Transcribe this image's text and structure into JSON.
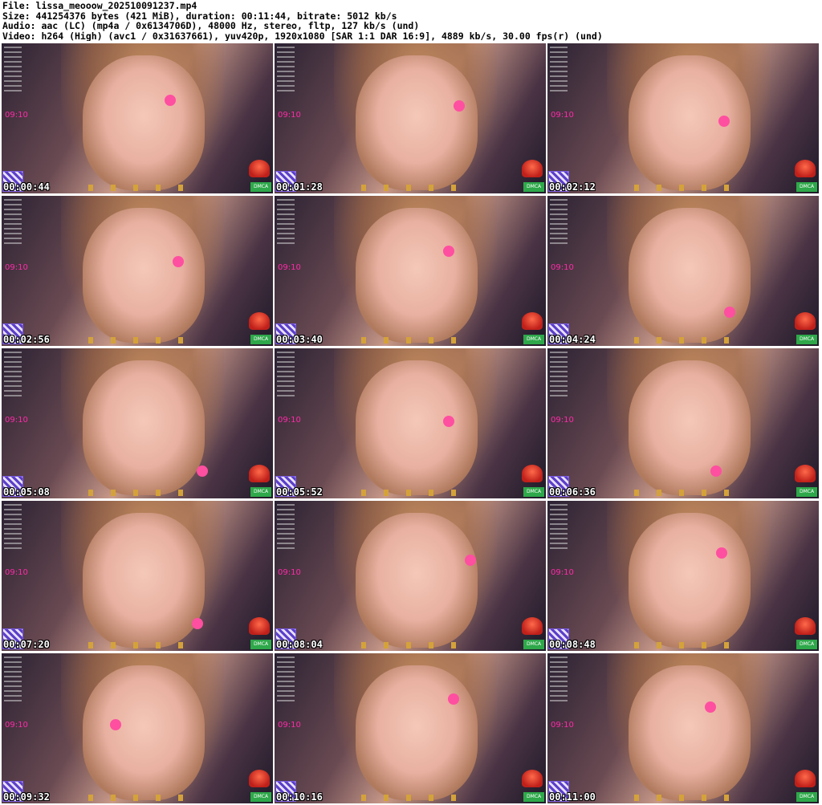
{
  "header": {
    "file_line": "File: lissa_meooow_202510091237.mp4",
    "size_line": "Size: 441254376 bytes (421 MiB), duration: 00:11:44, bitrate: 5012 kb/s",
    "audio_line": "Audio: aac (LC) (mp4a / 0x6134706D), 48000 Hz, stereo, fltp, 127 kb/s (und)",
    "video_line": "Video: h264 (High) (avc1 / 0x31637661), yuv420p, 1920x1080 [SAR 1:1 DAR 16:9], 4889 kb/s, 30.00 fps(r) (und)"
  },
  "tile_overlay": {
    "clock_text": "09:10",
    "dmca_text": "DMCA",
    "nose_color": "#ff4fa0",
    "clock_color": "#ff2aa8"
  },
  "thumbnails": [
    {
      "timestamp": "00:00:44"
    },
    {
      "timestamp": "00:01:28"
    },
    {
      "timestamp": "00:02:12"
    },
    {
      "timestamp": "00:02:56"
    },
    {
      "timestamp": "00:03:40"
    },
    {
      "timestamp": "00:04:24"
    },
    {
      "timestamp": "00:05:08"
    },
    {
      "timestamp": "00:05:52"
    },
    {
      "timestamp": "00:06:36"
    },
    {
      "timestamp": "00:07:20"
    },
    {
      "timestamp": "00:08:04"
    },
    {
      "timestamp": "00:08:48"
    },
    {
      "timestamp": "00:09:32"
    },
    {
      "timestamp": "00:10:16"
    },
    {
      "timestamp": "00:11:00"
    }
  ]
}
